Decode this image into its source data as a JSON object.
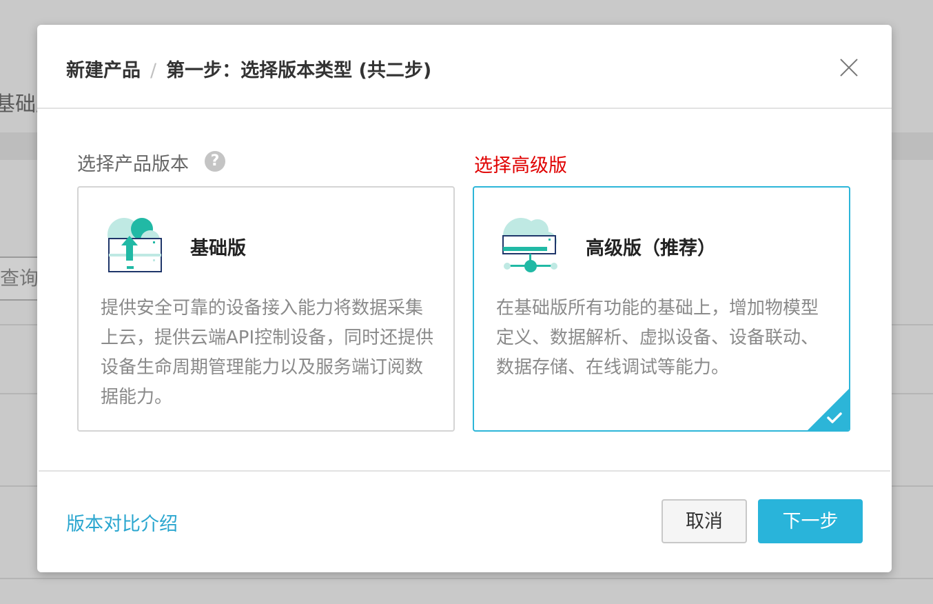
{
  "background": {
    "edition_text": "基础版",
    "query_button": "查询"
  },
  "modal": {
    "title": "新建产品",
    "step_title": "第一步：选择版本类型 (共二步)",
    "section_label": "选择产品版本",
    "help_icon_glyph": "?",
    "annotation": "选择高级版",
    "cards": [
      {
        "title": "基础版",
        "icon": "cloud-upload-icon",
        "description": "提供安全可靠的设备接入能力将数据采集上云，提供云端API控制设备，同时还提供设备生命周期管理能力以及服务端订阅数据能力。",
        "selected": false
      },
      {
        "title": "高级版（推荐）",
        "icon": "cloud-network-icon",
        "description": "在基础版所有功能的基础上，增加物模型定义、数据解析、虚拟设备、设备联动、数据存储、在线调试等能力。",
        "selected": true
      }
    ],
    "footer": {
      "compare_link": "版本对比介绍",
      "cancel_label": "取消",
      "next_label": "下一步"
    }
  },
  "colors": {
    "accent": "#29b4da",
    "annotation": "#e00000",
    "icon_teal": "#21b9a5",
    "icon_navy": "#1e3569"
  }
}
